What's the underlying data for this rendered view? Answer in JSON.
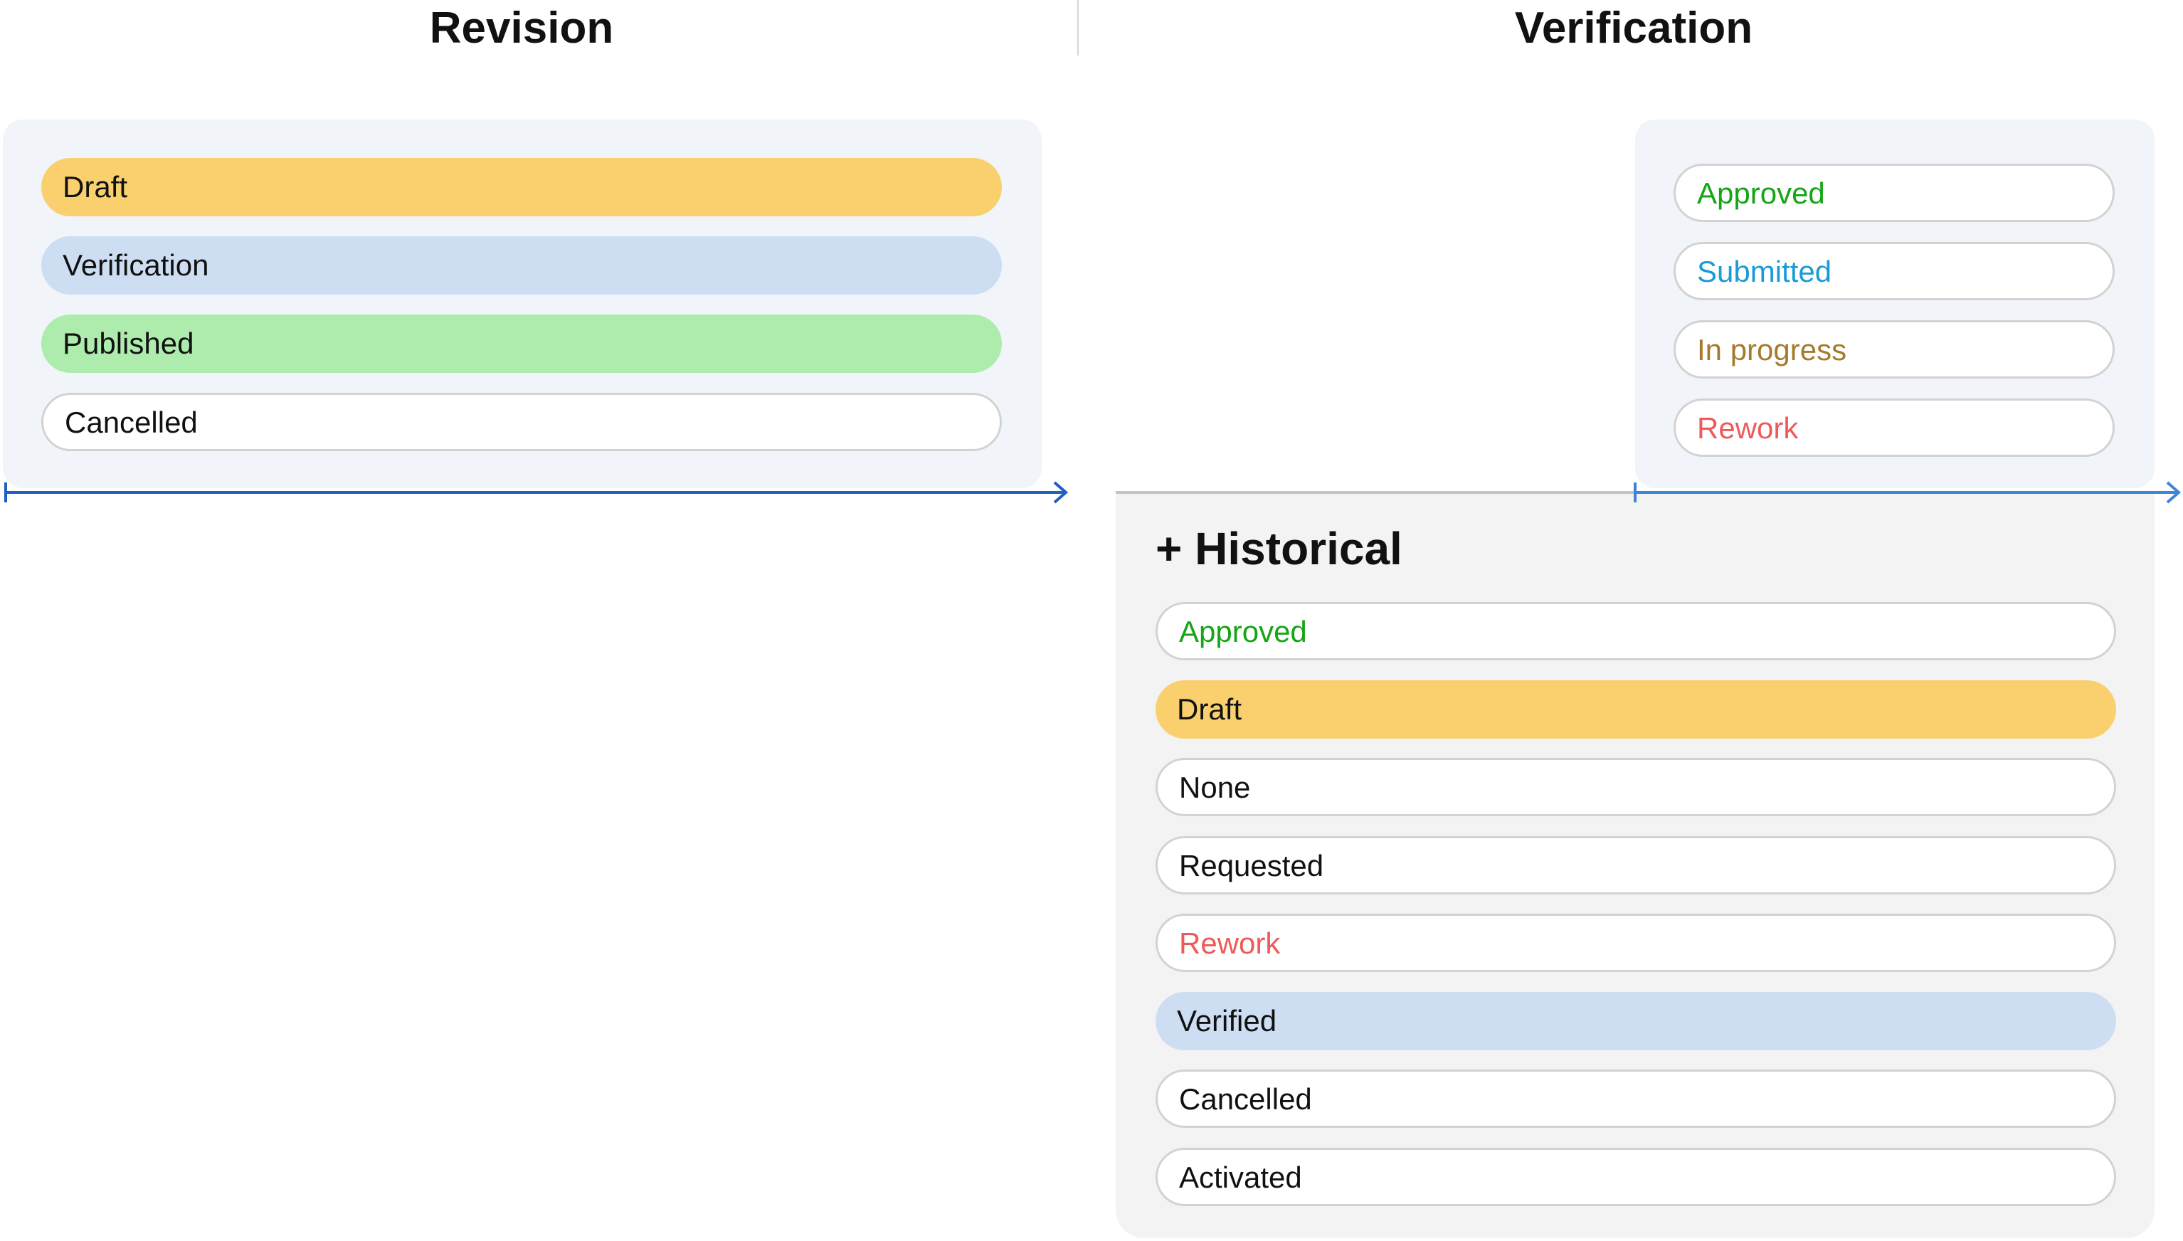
{
  "colors": {
    "draft_fill": "#f9d06d",
    "verification_fill": "#cddef3",
    "published_fill": "#aeecad",
    "panel_bg": "#f1f4f9",
    "historical_bg": "#f3f3f3",
    "axis_blue": "#1f5fbf",
    "approved_text": "#15a515",
    "submitted_text": "#1a9bd6",
    "in_progress_text": "#a57b2b",
    "rework_text": "#ee5a5a"
  },
  "revision": {
    "title": "Revision",
    "statuses": [
      {
        "label": "Draft",
        "style": "filled",
        "fill": "#f9d06d",
        "text_color": "#111111"
      },
      {
        "label": "Verification",
        "style": "filled",
        "fill": "#cddef3",
        "text_color": "#111111"
      },
      {
        "label": "Published",
        "style": "filled",
        "fill": "#aeecad",
        "text_color": "#111111"
      },
      {
        "label": "Cancelled",
        "style": "outline",
        "fill": "#ffffff",
        "text_color": "#111111"
      }
    ]
  },
  "verification": {
    "title": "Verification",
    "statuses": [
      {
        "label": "Approved",
        "style": "outline",
        "fill": "#ffffff",
        "text_color": "#15a515"
      },
      {
        "label": "Submitted",
        "style": "outline",
        "fill": "#ffffff",
        "text_color": "#1a9bd6"
      },
      {
        "label": "In progress",
        "style": "outline",
        "fill": "#ffffff",
        "text_color": "#a57b2b"
      },
      {
        "label": "Rework",
        "style": "outline",
        "fill": "#ffffff",
        "text_color": "#ee5a5a"
      }
    ],
    "historical": {
      "title": "+ Historical",
      "statuses": [
        {
          "label": "Approved",
          "style": "outline",
          "fill": "#ffffff",
          "text_color": "#15a515"
        },
        {
          "label": "Draft",
          "style": "filled",
          "fill": "#f9d06d",
          "text_color": "#111111"
        },
        {
          "label": "None",
          "style": "outline",
          "fill": "#ffffff",
          "text_color": "#111111"
        },
        {
          "label": "Requested",
          "style": "outline",
          "fill": "#ffffff",
          "text_color": "#111111"
        },
        {
          "label": "Rework",
          "style": "outline",
          "fill": "#ffffff",
          "text_color": "#ee5a5a"
        },
        {
          "label": "Verified",
          "style": "filled",
          "fill": "#cddef3",
          "text_color": "#111111"
        },
        {
          "label": "Cancelled",
          "style": "outline",
          "fill": "#ffffff",
          "text_color": "#111111"
        },
        {
          "label": "Activated",
          "style": "outline",
          "fill": "#ffffff",
          "text_color": "#111111"
        }
      ]
    }
  }
}
